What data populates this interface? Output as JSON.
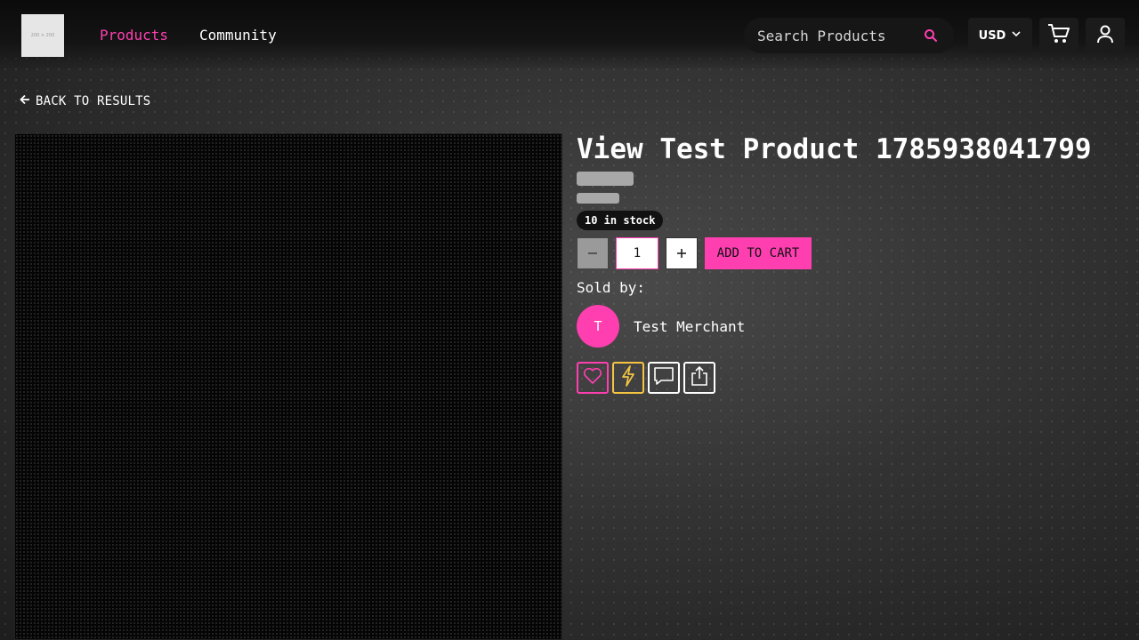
{
  "header": {
    "logo_text": "200 × 200",
    "nav": [
      {
        "label": "Products",
        "active": true
      },
      {
        "label": "Community",
        "active": false
      }
    ],
    "search_placeholder": "Search Products",
    "currency": "USD",
    "accent_color": "#ff3fb0"
  },
  "back_label": "BACK TO RESULTS",
  "product": {
    "title": "View Test Product 1785938041799",
    "stock_label": "10 in stock",
    "quantity": "1",
    "add_to_cart_label": "ADD TO CART",
    "sold_by_label": "Sold by:",
    "merchant_initial": "T",
    "merchant_name": "Test Merchant"
  },
  "icons": [
    "search-icon",
    "chevron-down-icon",
    "cart-icon",
    "user-icon",
    "arrow-left-icon",
    "minus-icon",
    "plus-icon",
    "heart-icon",
    "lightning-icon",
    "message-icon",
    "share-icon"
  ]
}
